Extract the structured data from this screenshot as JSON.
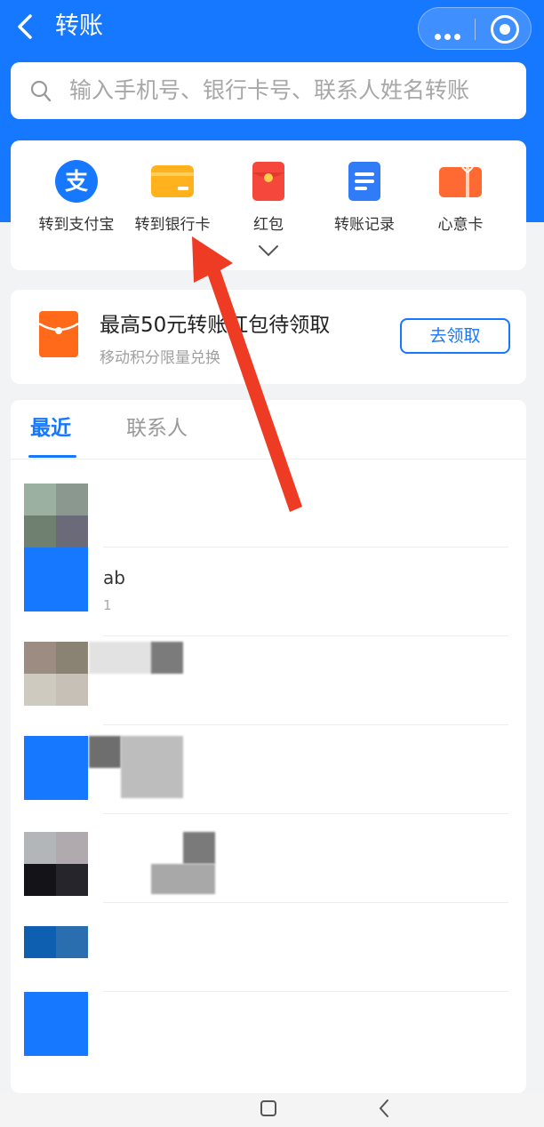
{
  "header": {
    "title": "转账",
    "back_icon": "chevron-left-icon",
    "more_icon": "more-dots-icon",
    "close_icon": "target-circle-icon",
    "bg_color": "#1677ff"
  },
  "search": {
    "placeholder": "输入手机号、银行卡号、联系人姓名转账",
    "icon": "search-icon"
  },
  "actions": [
    {
      "label": "转到支付宝",
      "icon": "alipay-icon"
    },
    {
      "label": "转到银行卡",
      "icon": "bank-card-icon"
    },
    {
      "label": "红包",
      "icon": "red-envelope-icon"
    },
    {
      "label": "转账记录",
      "icon": "records-icon"
    },
    {
      "label": "心意卡",
      "icon": "gift-card-icon"
    }
  ],
  "expand_icon": "chevron-down-icon",
  "promo": {
    "title": "最高50元转账红包待领取",
    "subtitle": "移动积分限量兑换",
    "button": "去领取",
    "icon": "red-envelope-icon"
  },
  "tabs": [
    {
      "label": "最近",
      "active": true
    },
    {
      "label": "联系人",
      "active": false
    }
  ],
  "contacts": [
    {
      "name": "",
      "sub": ""
    },
    {
      "name": "ab",
      "sub": "1"
    },
    {
      "name": "",
      "sub": ""
    },
    {
      "name": "",
      "sub": ""
    },
    {
      "name": "",
      "sub": ""
    },
    {
      "name": "",
      "sub": ""
    },
    {
      "name": "",
      "sub": ""
    }
  ],
  "system_nav": {
    "home_icon": "square-home-icon",
    "back_icon": "triangle-back-icon"
  },
  "colors": {
    "accent": "#1677ff",
    "annotation_arrow": "#ee3b23"
  }
}
